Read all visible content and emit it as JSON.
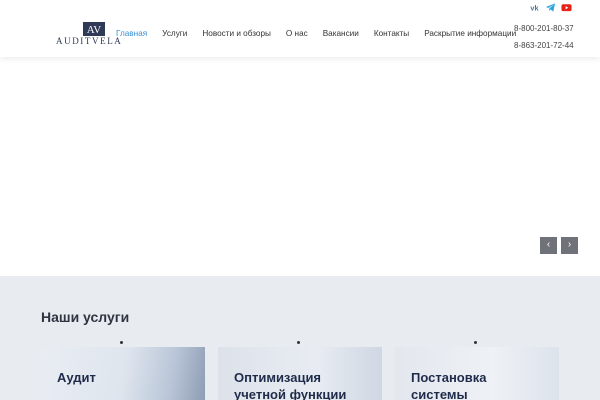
{
  "brand": {
    "logo_mark": "AV",
    "logo_text": "AUDITVELA"
  },
  "nav": {
    "items": [
      {
        "label": "Главная",
        "active": true
      },
      {
        "label": "Услуги"
      },
      {
        "label": "Новости и обзоры"
      },
      {
        "label": "О нас"
      },
      {
        "label": "Вакансии"
      },
      {
        "label": "Контакты"
      },
      {
        "label": "Раскрытие информации"
      }
    ]
  },
  "social": [
    {
      "icon": "vk-icon",
      "color": "#4a76a8"
    },
    {
      "icon": "telegram-icon",
      "color": "#2ca5e0"
    },
    {
      "icon": "youtube-icon",
      "color": "#e62117"
    }
  ],
  "phones": [
    "8-800-201-80-37",
    "8-863-201-72-44"
  ],
  "slider": {
    "prev": "‹",
    "next": "›"
  },
  "services": {
    "title": "Наши услуги",
    "cards": [
      {
        "title_lines": [
          "Аудит"
        ]
      },
      {
        "title_lines": [
          "Оптимизация",
          "учетной функции"
        ]
      },
      {
        "title_lines": [
          "Постановка",
          "системы"
        ]
      }
    ]
  },
  "colors": {
    "accent": "#3b8fd4",
    "brand_dark": "#2f3a56",
    "services_bg": "#e8ebf0"
  }
}
